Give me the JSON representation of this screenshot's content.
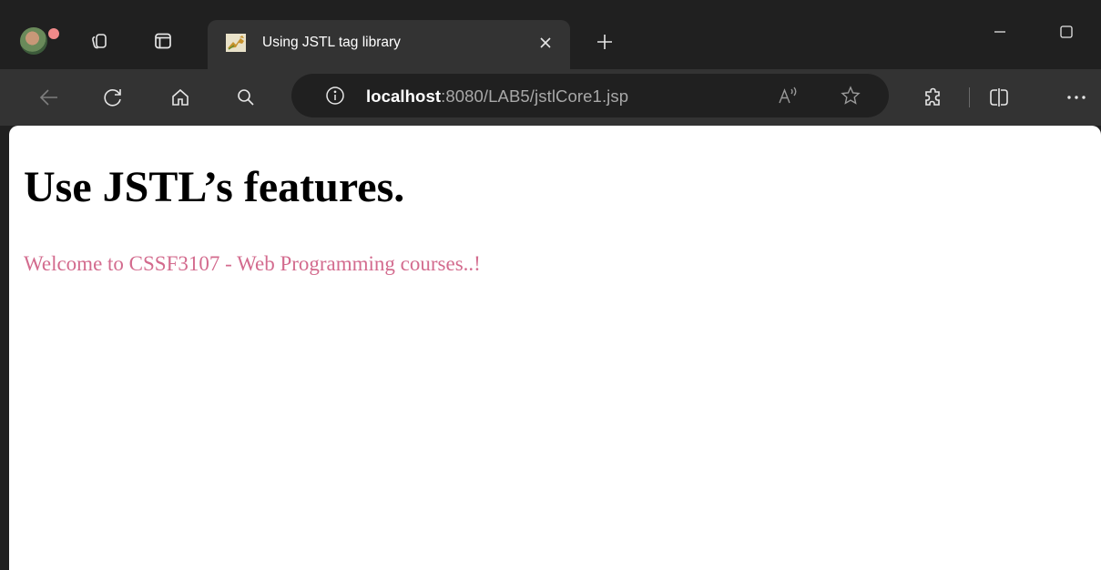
{
  "colors": {
    "frame": "#202020",
    "toolbar": "#333333",
    "page_background": "#ffffff",
    "welcome_text": "#d36b8e"
  },
  "browser": {
    "tab": {
      "title": "Using JSTL tag library",
      "favicon": "tomcat-favicon-icon"
    },
    "address_bar": {
      "host": "localhost",
      "rest": ":8080/LAB5/jstlCore1.jsp"
    },
    "icons": {
      "profile": "profile-avatar",
      "workspaces": "workspaces-icon",
      "tab_actions": "tab-actions-icon",
      "close_tab": "close-icon",
      "new_tab": "plus-icon",
      "minimize": "minimize-icon",
      "maximize": "maximize-icon",
      "back": "back-arrow-icon",
      "refresh": "refresh-icon",
      "home": "home-icon",
      "search": "search-icon",
      "site_info": "info-icon",
      "read_aloud": "read-aloud-icon",
      "favorite": "star-icon",
      "extensions": "extensions-icon",
      "split_screen": "split-screen-icon",
      "more": "more-icon"
    }
  },
  "page": {
    "heading": "Use JSTL’s features.",
    "welcome": "Welcome to CSSF3107 - Web Programming courses..!"
  }
}
